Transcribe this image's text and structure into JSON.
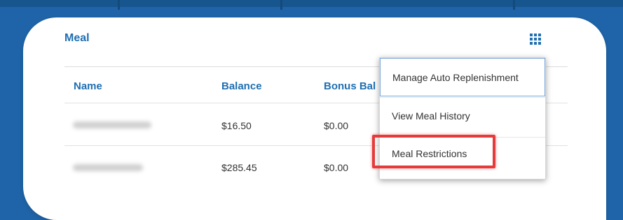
{
  "card": {
    "title": "Meal",
    "menu_icon": "grid-icon"
  },
  "table": {
    "columns": [
      "Name",
      "Balance",
      "Bonus Bal"
    ],
    "rows": [
      {
        "name": "",
        "balance": "$16.50",
        "bonus_balance": "$0.00"
      },
      {
        "name": "",
        "balance": "$285.45",
        "bonus_balance": "$0.00"
      }
    ]
  },
  "dropdown": {
    "items": [
      {
        "label": "Manage Auto Replenishment"
      },
      {
        "label": "View Meal History"
      },
      {
        "label": "Meal Restrictions"
      }
    ]
  },
  "colors": {
    "accent": "#1f6fb2",
    "background": "#1f64a8",
    "highlight": "#e53b3b"
  }
}
